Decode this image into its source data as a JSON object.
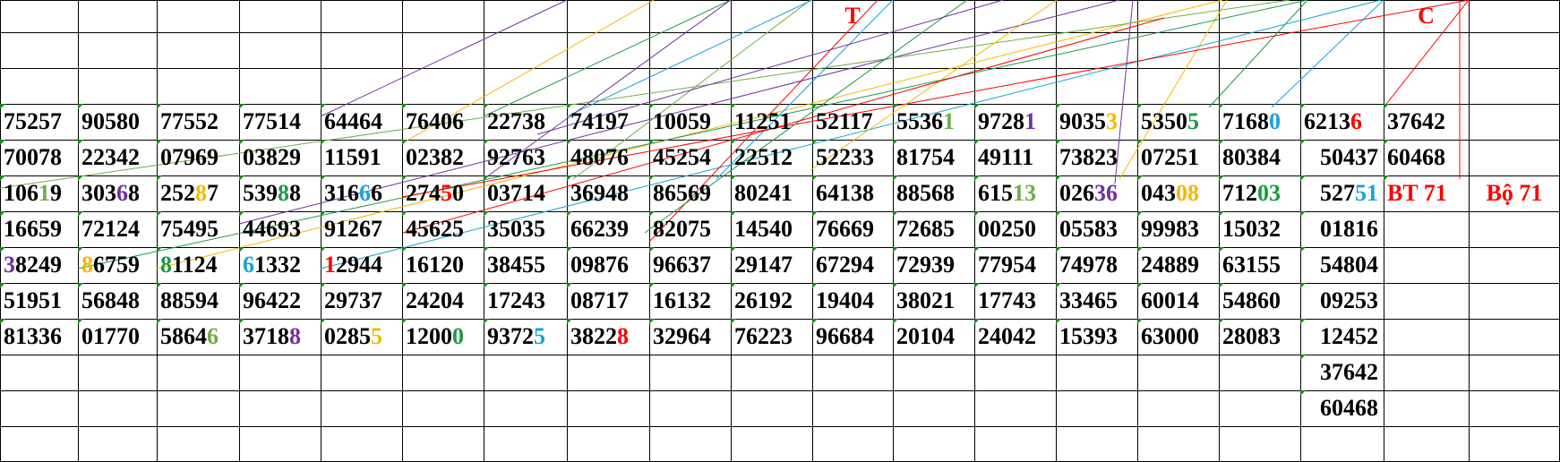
{
  "colors": {
    "purple": "#7030a0",
    "orange": "#f5b800",
    "green": "#1a9a45",
    "lightgreen": "#70ad47",
    "blue": "#17a3d8",
    "red": "#ff0000",
    "gridline": "#000000"
  },
  "header_markers": [
    {
      "text": "T",
      "col": 10,
      "color": "#ff0000"
    },
    {
      "text": "C",
      "col": 17,
      "color": "#ff0000"
    }
  ],
  "rows": [
    {
      "cells": [
        [
          "75257"
        ],
        [
          "90580"
        ],
        [
          "77552"
        ],
        [
          "77514"
        ],
        [
          "64464"
        ],
        [
          "76406"
        ],
        [
          "22738"
        ],
        [
          "74197"
        ],
        [
          "10059"
        ],
        [
          "11251"
        ],
        [
          "52117"
        ],
        [
          {
            "t": "5536"
          },
          {
            "t": "1",
            "c": "lightgreen"
          }
        ],
        [
          {
            "t": "9728"
          },
          {
            "t": "1",
            "c": "purple"
          }
        ],
        [
          {
            "t": "9035"
          },
          {
            "t": "3",
            "c": "orange"
          }
        ],
        [
          {
            "t": "5350"
          },
          {
            "t": "5",
            "c": "green"
          }
        ],
        [
          {
            "t": "7168"
          },
          {
            "t": "0",
            "c": "blue"
          }
        ],
        [
          {
            "t": "6213"
          },
          {
            "t": "6",
            "c": "red"
          }
        ],
        [
          "37642"
        ]
      ]
    },
    {
      "cells": [
        [
          "70078"
        ],
        [
          "22342"
        ],
        [
          "07969"
        ],
        [
          "03829"
        ],
        [
          "11591"
        ],
        [
          "02382"
        ],
        [
          "92763"
        ],
        [
          "48076"
        ],
        [
          "45254"
        ],
        [
          "22512"
        ],
        [
          "52233"
        ],
        [
          "81754"
        ],
        [
          "49111"
        ],
        [
          "73823"
        ],
        [
          "07251"
        ],
        [
          "80384"
        ],
        [
          "50437"
        ],
        [
          "60468"
        ]
      ]
    },
    {
      "cells": [
        [
          {
            "t": "106"
          },
          {
            "t": "1",
            "c": "lightgreen"
          },
          {
            "t": "9"
          }
        ],
        [
          {
            "t": "303"
          },
          {
            "t": "6",
            "c": "purple"
          },
          {
            "t": "8"
          }
        ],
        [
          {
            "t": "252"
          },
          {
            "t": "8",
            "c": "orange"
          },
          {
            "t": "7"
          }
        ],
        [
          {
            "t": "539"
          },
          {
            "t": "8",
            "c": "green"
          },
          {
            "t": "8"
          }
        ],
        [
          {
            "t": "316"
          },
          {
            "t": "6",
            "c": "blue"
          },
          {
            "t": "6"
          }
        ],
        [
          {
            "t": "274"
          },
          {
            "t": "5",
            "c": "red"
          },
          {
            "t": "0"
          }
        ],
        [
          "03714"
        ],
        [
          "36948"
        ],
        [
          "86569"
        ],
        [
          "80241"
        ],
        [
          "64138"
        ],
        [
          "88568"
        ],
        [
          {
            "t": "615"
          },
          {
            "t": "13",
            "c": "lightgreen"
          }
        ],
        [
          {
            "t": "026"
          },
          {
            "t": "36",
            "c": "purple"
          }
        ],
        [
          {
            "t": "043"
          },
          {
            "t": "08",
            "c": "orange"
          }
        ],
        [
          {
            "t": "712"
          },
          {
            "t": "03",
            "c": "green"
          }
        ],
        [
          {
            "t": "527"
          },
          {
            "t": "51",
            "c": "blue"
          }
        ],
        [
          {
            "t": "BT 71",
            "c": "red"
          }
        ]
      ]
    },
    {
      "cells": [
        [
          "16659"
        ],
        [
          "72124"
        ],
        [
          "75495"
        ],
        [
          "44693"
        ],
        [
          "91267"
        ],
        [
          "45625"
        ],
        [
          "35035"
        ],
        [
          "66239"
        ],
        [
          "82075"
        ],
        [
          "14540"
        ],
        [
          "76669"
        ],
        [
          "72685"
        ],
        [
          "00250"
        ],
        [
          "05583"
        ],
        [
          "99983"
        ],
        [
          "15032"
        ],
        [
          "01816"
        ]
      ]
    },
    {
      "cells": [
        [
          {
            "t": "3",
            "c": "purple"
          },
          {
            "t": "8249"
          }
        ],
        [
          {
            "t": "8",
            "c": "orange"
          },
          {
            "t": "6759"
          }
        ],
        [
          {
            "t": "8",
            "c": "green"
          },
          {
            "t": "1124"
          }
        ],
        [
          {
            "t": "6",
            "c": "blue"
          },
          {
            "t": "1332"
          }
        ],
        [
          {
            "t": "1",
            "c": "red"
          },
          {
            "t": "2944"
          }
        ],
        [
          "16120"
        ],
        [
          "38455"
        ],
        [
          "09876"
        ],
        [
          "96637"
        ],
        [
          "29147"
        ],
        [
          "67294"
        ],
        [
          "72939"
        ],
        [
          "77954"
        ],
        [
          "74978"
        ],
        [
          "24889"
        ],
        [
          "63155"
        ],
        [
          "54804"
        ]
      ]
    },
    {
      "cells": [
        [
          "51951"
        ],
        [
          "56848"
        ],
        [
          "88594"
        ],
        [
          "96422"
        ],
        [
          "29737"
        ],
        [
          "24204"
        ],
        [
          "17243"
        ],
        [
          "08717"
        ],
        [
          "16132"
        ],
        [
          "26192"
        ],
        [
          "19404"
        ],
        [
          "38021"
        ],
        [
          "17743"
        ],
        [
          "33465"
        ],
        [
          "60014"
        ],
        [
          "54860"
        ],
        [
          "09253"
        ]
      ]
    },
    {
      "cells": [
        [
          "81336"
        ],
        [
          "01770"
        ],
        [
          {
            "t": "5864"
          },
          {
            "t": "6",
            "c": "lightgreen"
          }
        ],
        [
          {
            "t": "3718"
          },
          {
            "t": "8",
            "c": "purple"
          }
        ],
        [
          {
            "t": "0285"
          },
          {
            "t": "5",
            "c": "orange"
          }
        ],
        [
          {
            "t": "1200"
          },
          {
            "t": "0",
            "c": "green"
          }
        ],
        [
          {
            "t": "9372"
          },
          {
            "t": "5",
            "c": "blue"
          }
        ],
        [
          {
            "t": "3822"
          },
          {
            "t": "8",
            "c": "red"
          }
        ],
        [
          "32964"
        ],
        [
          "76223"
        ],
        [
          "96684"
        ],
        [
          "20104"
        ],
        [
          "24042"
        ],
        [
          "15393"
        ],
        [
          "63000"
        ],
        [
          "28083"
        ],
        [
          "12452"
        ]
      ]
    },
    {
      "cells": [
        [],
        [],
        [],
        [],
        [],
        [],
        [],
        [],
        [],
        [],
        [],
        [],
        [],
        [],
        [],
        [],
        [
          "37642"
        ]
      ]
    },
    {
      "cells": [
        [],
        [],
        [],
        [],
        [],
        [],
        [],
        [],
        [],
        [],
        [],
        [],
        [],
        [],
        [],
        [],
        [
          "60468"
        ]
      ]
    }
  ],
  "extra_label": {
    "text": "Bộ 71",
    "color": "#ff0000"
  }
}
